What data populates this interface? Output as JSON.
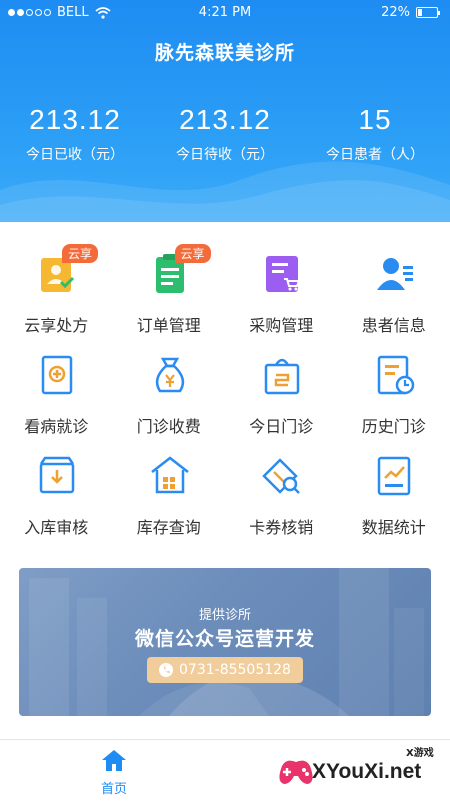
{
  "status_bar": {
    "carrier": "BELL",
    "time": "4:21 PM",
    "battery": "22%",
    "battery_level": 0.22
  },
  "header": {
    "title": "脉先森联美诊所",
    "stats": [
      {
        "value": "213.12",
        "label": "今日已收（元）"
      },
      {
        "value": "213.12",
        "label": "今日待收（元）"
      },
      {
        "value": "15",
        "label": "今日患者（人）"
      }
    ]
  },
  "menu": [
    {
      "label": "云享处方",
      "badge": "云享",
      "icon": "prescription-icon",
      "color": "#f5b830"
    },
    {
      "label": "订单管理",
      "badge": "云享",
      "icon": "order-icon",
      "color": "#2dbd6e"
    },
    {
      "label": "采购管理",
      "icon": "purchase-icon",
      "color": "#9b5ef0"
    },
    {
      "label": "患者信息",
      "icon": "patient-icon",
      "color": "#2a8cf0"
    },
    {
      "label": "看病就诊",
      "icon": "consultation-icon",
      "color": "#f0a030"
    },
    {
      "label": "门诊收费",
      "icon": "money-bag-icon",
      "color": "#f0a030"
    },
    {
      "label": "今日门诊",
      "icon": "today-clinic-icon",
      "color": "#f0a030"
    },
    {
      "label": "历史门诊",
      "icon": "history-clinic-icon",
      "color": "#f0a030"
    },
    {
      "label": "入库审核",
      "icon": "inbound-icon",
      "color": "#2a8cf0"
    },
    {
      "label": "库存查询",
      "icon": "warehouse-icon",
      "color": "#2a8cf0"
    },
    {
      "label": "卡券核销",
      "icon": "coupon-icon",
      "color": "#2a8cf0"
    },
    {
      "label": "数据统计",
      "icon": "statistics-icon",
      "color": "#2a8cf0"
    }
  ],
  "banner": {
    "overtitle": "提供诊所",
    "title": "微信公众号运营开发",
    "phone": "0731-85505128"
  },
  "tabbar": {
    "home_label": "首页"
  },
  "watermark": {
    "text": "XYouXi.net",
    "small": "X游戏"
  },
  "colors": {
    "primary": "#1e8cf2",
    "badge": "#f46b3b",
    "phone_pill": "#f0cd9a"
  }
}
